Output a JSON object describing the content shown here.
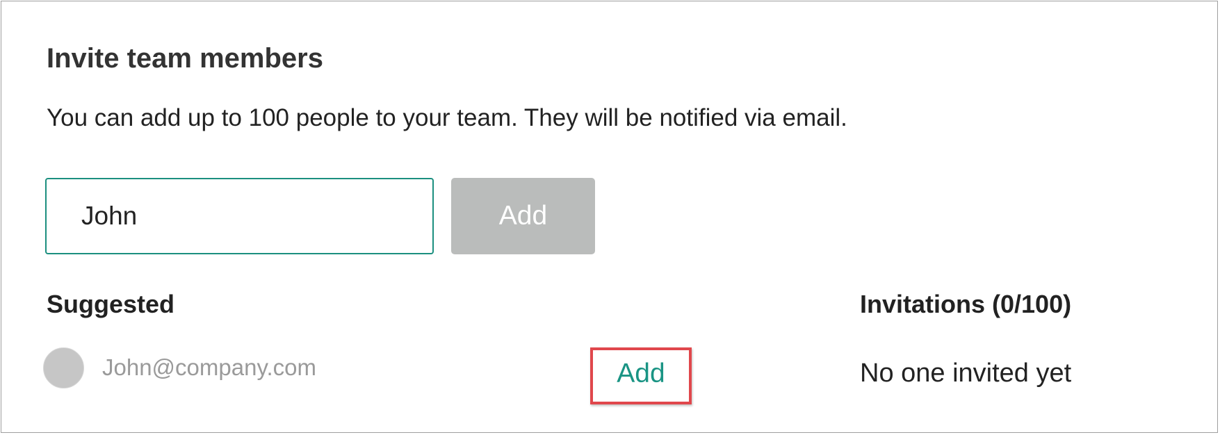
{
  "invite": {
    "title": "Invite team members",
    "description": "You can add up to 100 people to your team. They will be notified via email.",
    "input_value": "John",
    "add_button_label": "Add"
  },
  "suggested": {
    "heading": "Suggested",
    "items": [
      {
        "email": "John@company.com",
        "add_label": "Add"
      }
    ]
  },
  "invitations": {
    "heading": "Invitations (0/100)",
    "empty_text": "No one invited yet"
  },
  "colors": {
    "accent": "#1a9484",
    "input_border": "#1b8f7f",
    "disabled_button": "#babcbb",
    "avatar": "#c6c6c6",
    "highlight_box": "#e0474c"
  }
}
